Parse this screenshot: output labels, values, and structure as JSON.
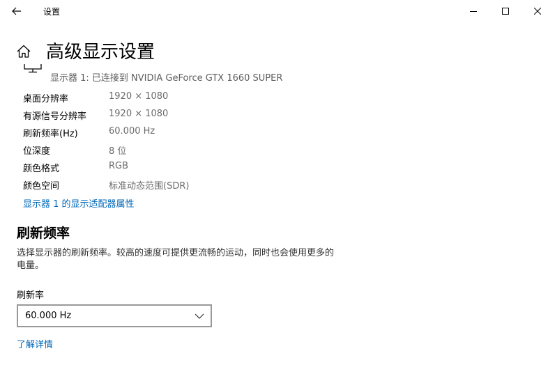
{
  "window": {
    "title": "设置",
    "minimize_icon": "minimize-icon",
    "maximize_icon": "maximize-icon",
    "close_icon": "close-icon",
    "back_icon": "back-arrow-icon"
  },
  "header": {
    "home_icon": "home-icon",
    "title": "高级显示设置"
  },
  "display": {
    "icon": "monitor-icon",
    "label": "显示器 1: 已连接到 NVIDIA GeForce GTX 1660 SUPER",
    "properties": [
      {
        "key": "桌面分辨率",
        "value": "1920 × 1080"
      },
      {
        "key": "有源信号分辨率",
        "value": "1920 × 1080"
      },
      {
        "key": "刷新频率(Hz)",
        "value": "60.000 Hz"
      },
      {
        "key": "位深度",
        "value": "8 位"
      },
      {
        "key": "颜色格式",
        "value": "RGB"
      },
      {
        "key": "颜色空间",
        "value": "标准动态范围(SDR)"
      }
    ],
    "adapter_link": "显示器 1 的显示适配器属性"
  },
  "refresh": {
    "title": "刷新频率",
    "description": "选择显示器的刷新频率。较高的速度可提供更流畅的运动，同时也会使用更多的电量。",
    "field_label": "刷新率",
    "selected": "60.000 Hz",
    "learn_more": "了解详情"
  },
  "colors": {
    "link": "#0067b8",
    "secondary_text": "#6b6b6b",
    "select_border": "#999999"
  }
}
